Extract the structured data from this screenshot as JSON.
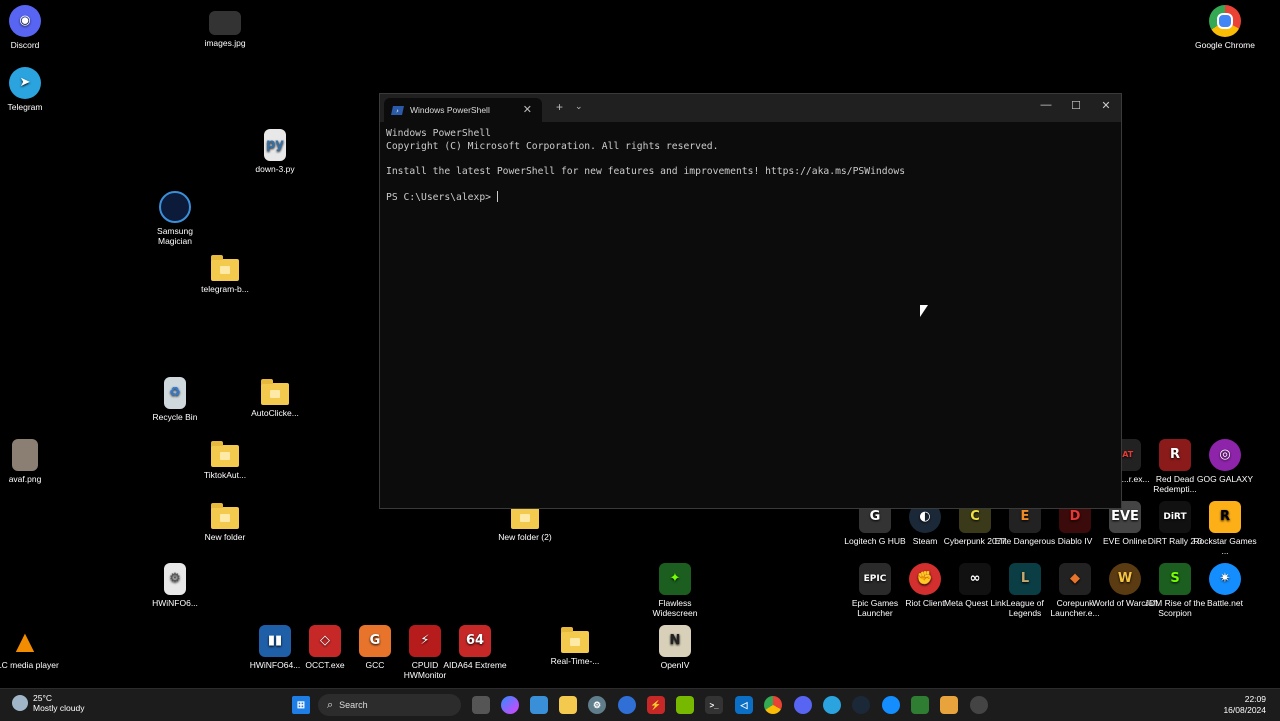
{
  "desktop_icons": {
    "discord": "Discord",
    "images": "images.jpg",
    "chrome": "Google Chrome",
    "telegram": "Telegram",
    "down3": "down-3.py",
    "samsung": "Samsung Magician",
    "telegram_b": "telegram-b...",
    "recycle": "Recycle Bin",
    "autoclicker": "AutoClicke...",
    "avaf": "avaf.png",
    "tiktok": "TiktokAut...",
    "newfolder": "New folder",
    "newfolder2": "New folder (2)",
    "hwinfo_file": "HWiNFO6...",
    "vlc": "VLC media player",
    "hwinfo64": "HWiNFO64...",
    "occt": "OCCT.exe",
    "gcc": "GCC",
    "cpuid": "CPUID HWMonitor",
    "aida": "AIDA64 Extreme",
    "realtime": "Real-Time-...",
    "flawless": "Flawless Widescreen",
    "openiv": "OpenIV",
    "cheat": "...eat ...r.ex...",
    "rdr": "Red Dead Redempti...",
    "gog": "GOG GALAXY",
    "logitech": "Logitech G HUB",
    "steam": "Steam",
    "cyberpunk": "Cyberpunk 2077",
    "elite": "Elite Dangerous",
    "diablo": "Diablo IV",
    "eve": "EVE Online",
    "dirt": "DiRT Rally 2.0",
    "rockstar": "Rockstar Games ...",
    "epic": "Epic Games Launcher",
    "riot": "Riot Client",
    "meta": "Meta Quest Link",
    "lol": "League of Legends",
    "corepunk": "Corepunk Launcher.e...",
    "wow": "World of Warcraft",
    "jdm": "JDM Rise of the Scorpion",
    "battlenet": "Battle.net"
  },
  "terminal": {
    "tab_title": "Windows PowerShell",
    "line1": "Windows PowerShell",
    "line2": "Copyright (C) Microsoft Corporation. All rights reserved.",
    "line3": "Install the latest PowerShell for new features and improvements! https://aka.ms/PSWindows",
    "prompt": "PS C:\\Users\\alexp> "
  },
  "taskbar": {
    "weather_temp": "25°C",
    "weather_desc": "Mostly cloudy",
    "search_placeholder": "Search",
    "time": "22:09",
    "date": "16/08/2024"
  },
  "colors": {
    "desktop_bg": "#000000",
    "terminal_bg": "#0c0c0c",
    "taskbar_bg": "#1c1c1c"
  }
}
